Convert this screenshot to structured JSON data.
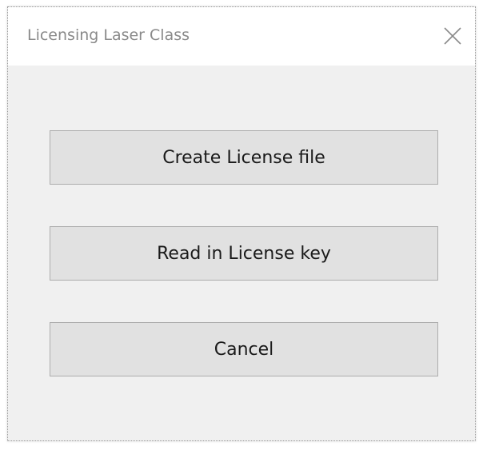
{
  "dialog": {
    "title": "Licensing Laser Class",
    "close_icon": "close-icon"
  },
  "buttons": {
    "create_license_file": "Create License file",
    "read_in_license_key": "Read in License key",
    "cancel": "Cancel"
  },
  "colors": {
    "dialog_background": "#f0f0f0",
    "titlebar_background": "#ffffff",
    "button_background": "#e1e1e1",
    "button_border": "#adadad",
    "title_text": "#8a8a8a"
  }
}
